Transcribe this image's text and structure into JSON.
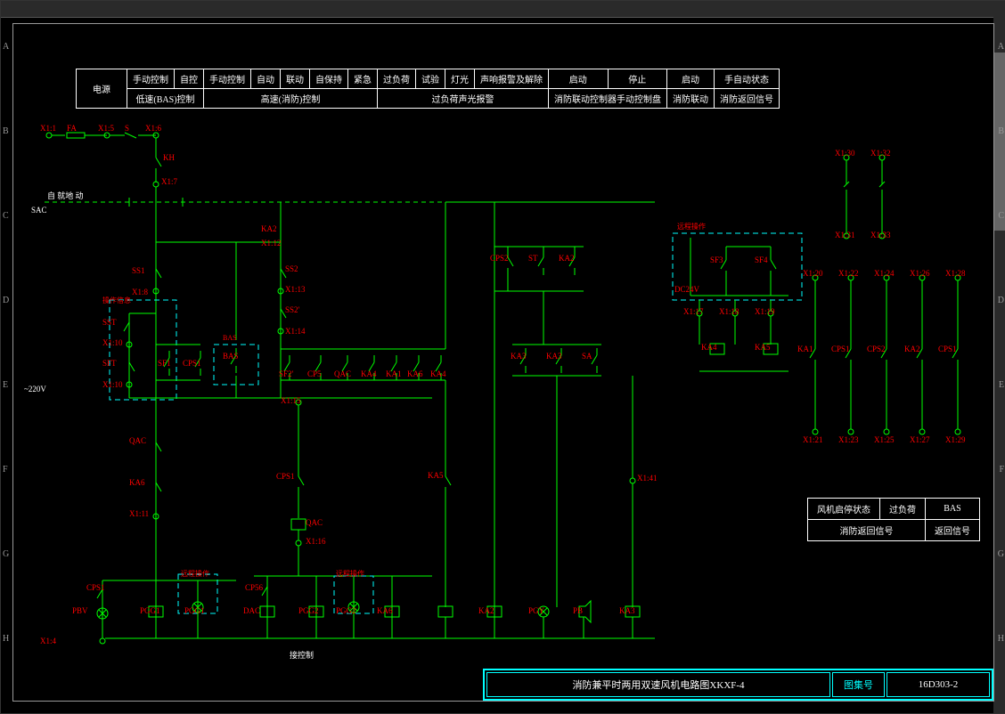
{
  "grid_letters": [
    "A",
    "B",
    "C",
    "D",
    "E",
    "F",
    "G",
    "H"
  ],
  "header": {
    "row1": [
      "电源",
      "手动控制",
      "自控",
      "手动控制",
      "自动",
      "联动",
      "自保持",
      "紧急",
      "过负荷",
      "试验",
      "灯光",
      "声响报警及解除",
      "启动",
      "停止",
      "启动",
      "手自动状态"
    ],
    "row2": [
      "低速(BAS)控制",
      "高速(消防)控制",
      "过负荷声光报警",
      "消防联动控制器手动控制盘",
      "消防联动",
      "消防返回信号"
    ]
  },
  "labels": {
    "x11": "X1:1",
    "fa": "FA",
    "x15": "X1:5",
    "s": "S",
    "x16": "X1:6",
    "kh": "KH",
    "x17": "X1:7",
    "sac": "SAC",
    "sac_note": "自   就地   动",
    "v220": "~220V",
    "ka2_top": "KA2",
    "x112": "X1:12",
    "ss1": "SS1",
    "x18": "X1:8",
    "sst": "SST",
    "x110": "X1:10",
    "sft": "SFT",
    "sf1": "SF1",
    "cps1": "CPS1",
    "bas": "BAS",
    "line_note": "操作信息",
    "x110b": "X1:10",
    "qac": "QAC",
    "ka6": "KA6",
    "x111": "X1:11",
    "ss2": "SS2",
    "x113": "X1:13",
    "ss2b": "SS2'",
    "x114": "X1:14",
    "sf2": "SF2'",
    "cp5": "CP5",
    "qac2": "QAC",
    "ka4": "KA4",
    "ka1": "KA1",
    "ka6b": "KA6",
    "ka4b": "KA4",
    "x115": "X1:15",
    "cps1b": "CPS1",
    "qacb": "QAC",
    "x116": "X1:16",
    "cp56": "CP56",
    "dac": "DAC",
    "pgg2r": "PGG2",
    "pgg2": "PGG2",
    "ka6c": "KA6",
    "ka5": "KA5",
    "cps2": "CPS2",
    "st": "ST",
    "ka2": "KA2",
    "ka3": "KA3",
    "sa": "SA",
    "ka2b": "KA2",
    "x141": "X1:41",
    "pgy": "PGY",
    "pb": "PB",
    "remote": "远程操作",
    "sf3": "SF3",
    "sf4": "SF4",
    "dc24": "DC24V",
    "x117": "X1:17",
    "x118": "X1:18",
    "x119": "X1:19",
    "ka4c": "KA4",
    "ka5b": "KA5",
    "ka1b": "KA1",
    "cps1c": "CPS1",
    "cps2b": "CPS2",
    "ka2c": "KA2",
    "cps1d": "CPS1",
    "x120": "X1:20",
    "x122": "X1:22",
    "x124": "X1:24",
    "x126": "X1:26",
    "x128": "X1:28",
    "x121": "X1:21",
    "x123": "X1:23",
    "x125": "X1:25",
    "x127": "X1:27",
    "x129": "X1:29",
    "x130": "X1:30",
    "x131": "X1:31",
    "x132": "X1:32",
    "x133": "X1:33",
    "pbv": "PBV",
    "x14": "X1:4",
    "pgg1": "PGG1",
    "bottom_note": "接控制",
    "note_box": "操作信息"
  },
  "bottom_right_table": {
    "r1": [
      "风机启停状态",
      "过负荷",
      "BAS"
    ],
    "r2": [
      "消防返回信号",
      "返回信号"
    ]
  },
  "title_block": {
    "title": "消防兼平时两用双速风机电路图XKXF-4",
    "col_label": "图集号",
    "code": "16D303-2"
  }
}
